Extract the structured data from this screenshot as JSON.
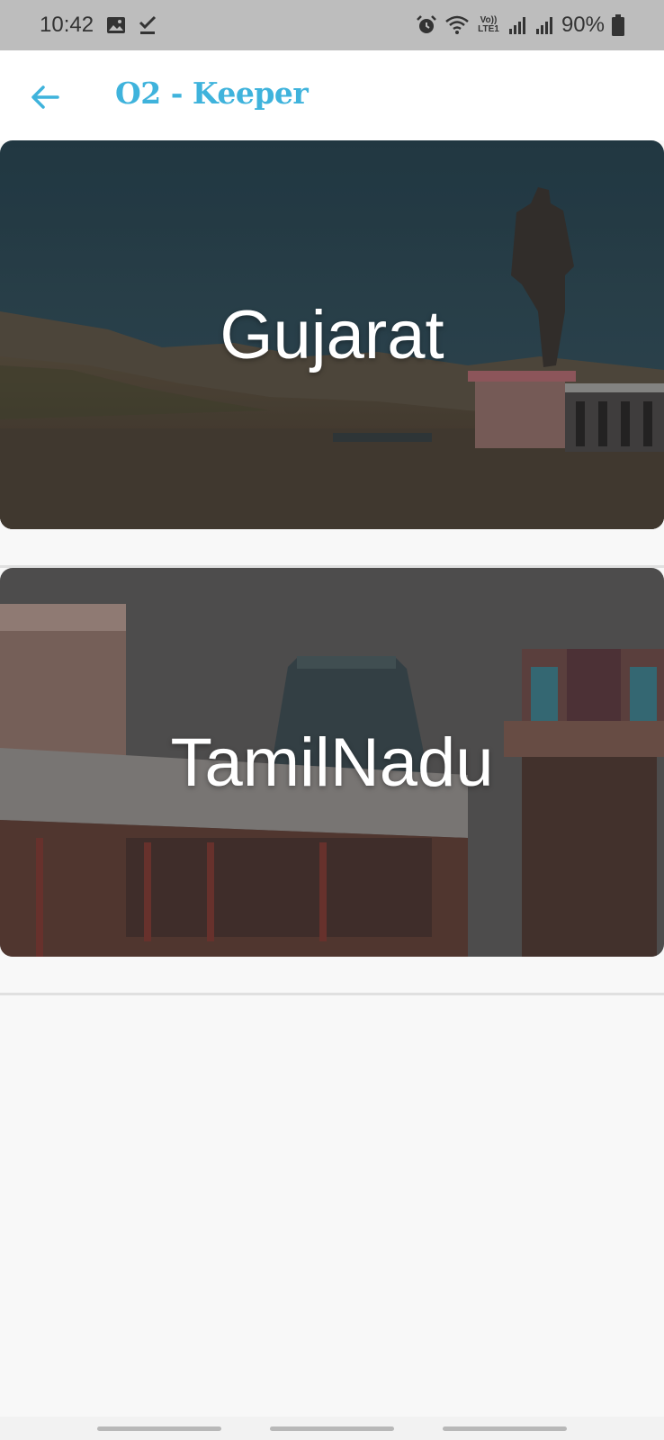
{
  "status_bar": {
    "time": "10:42",
    "battery": "90%",
    "network_label": "Vo)) LTE1",
    "icons": [
      "image-icon",
      "download-done-icon",
      "alarm-icon",
      "wifi-icon",
      "volte-icon",
      "signal-icon",
      "signal-icon",
      "battery-icon"
    ]
  },
  "app_bar": {
    "title": "O2 - Keeper",
    "back_icon": "arrow-left-icon",
    "accent_color": "#3fb3dc"
  },
  "states": [
    {
      "name": "Gujarat"
    },
    {
      "name": "TamilNadu"
    }
  ],
  "nav_bar": {
    "handles": 3
  }
}
